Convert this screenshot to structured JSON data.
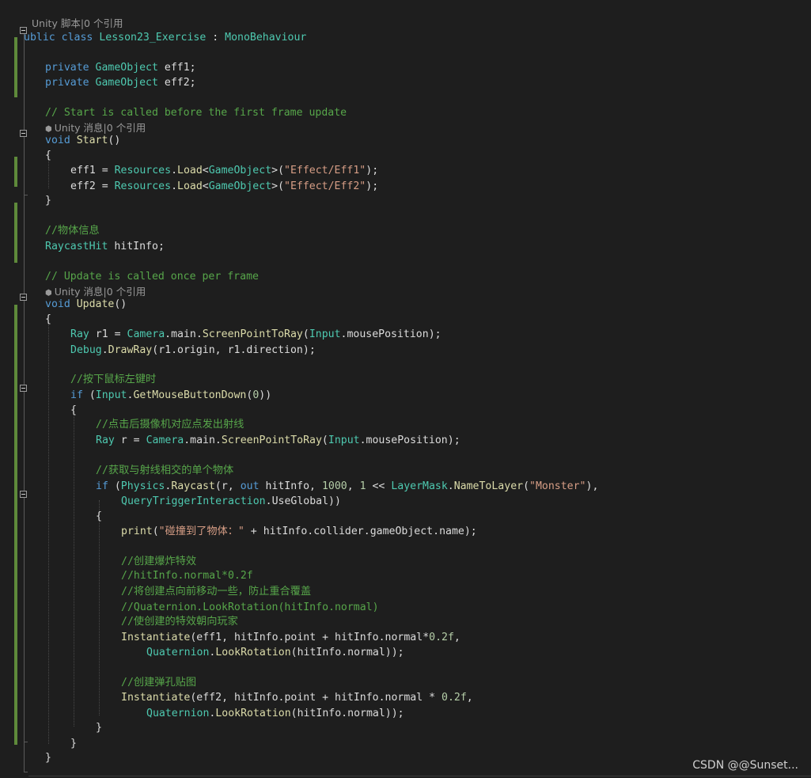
{
  "editor": {
    "lines": [
      {
        "kind": "lens",
        "text": "Unity 脚本|0 个引用"
      },
      {
        "kind": "code",
        "text": "ublic class Lesson23_Exercise : MonoBehaviour"
      },
      {
        "kind": "blank"
      },
      {
        "kind": "code",
        "text": "private GameObject eff1;"
      },
      {
        "kind": "code",
        "text": "private GameObject eff2;"
      },
      {
        "kind": "blank"
      },
      {
        "kind": "code",
        "text": "// Start is called before the first frame update"
      },
      {
        "kind": "lens",
        "text": "Unity 消息|0 个引用"
      },
      {
        "kind": "code",
        "text": "void Start()"
      },
      {
        "kind": "code",
        "text": "{"
      },
      {
        "kind": "code",
        "text": "eff1 = Resources.Load<GameObject>(\"Effect/Eff1\");"
      },
      {
        "kind": "code",
        "text": "eff2 = Resources.Load<GameObject>(\"Effect/Eff2\");"
      },
      {
        "kind": "code",
        "text": "}"
      },
      {
        "kind": "blank"
      },
      {
        "kind": "code",
        "text": "//物体信息"
      },
      {
        "kind": "code",
        "text": "RaycastHit hitInfo;"
      },
      {
        "kind": "blank"
      },
      {
        "kind": "code",
        "text": "// Update is called once per frame"
      },
      {
        "kind": "lens",
        "text": "Unity 消息|0 个引用"
      },
      {
        "kind": "code",
        "text": "void Update()"
      },
      {
        "kind": "code",
        "text": "{"
      },
      {
        "kind": "code",
        "text": "Ray r1 = Camera.main.ScreenPointToRay(Input.mousePosition);"
      },
      {
        "kind": "code",
        "text": "Debug.DrawRay(r1.origin, r1.direction);"
      },
      {
        "kind": "blank"
      },
      {
        "kind": "code",
        "text": "//按下鼠标左键时"
      },
      {
        "kind": "code",
        "text": "if (Input.GetMouseButtonDown(0))"
      },
      {
        "kind": "code",
        "text": "{"
      },
      {
        "kind": "code",
        "text": "//点击后摄像机对应点发出射线"
      },
      {
        "kind": "code",
        "text": "Ray r = Camera.main.ScreenPointToRay(Input.mousePosition);"
      },
      {
        "kind": "blank"
      },
      {
        "kind": "code",
        "text": "//获取与射线相交的单个物体"
      },
      {
        "kind": "code",
        "text": "if (Physics.Raycast(r, out hitInfo, 1000, 1 << LayerMask.NameToLayer(\"Monster\"),"
      },
      {
        "kind": "code",
        "text": "QueryTriggerInteraction.UseGlobal))"
      },
      {
        "kind": "code",
        "text": "{"
      },
      {
        "kind": "code",
        "text": "print(\"碰撞到了物体：\" + hitInfo.collider.gameObject.name);"
      },
      {
        "kind": "blank"
      },
      {
        "kind": "code",
        "text": "//创建爆炸特效"
      },
      {
        "kind": "code",
        "text": "//hitInfo.normal*0.2f"
      },
      {
        "kind": "code",
        "text": "//将创建点向前移动一些，防止重合覆盖"
      },
      {
        "kind": "code",
        "text": "//Quaternion.LookRotation(hitInfo.normal)"
      },
      {
        "kind": "code",
        "text": "//使创建的特效朝向玩家"
      },
      {
        "kind": "code",
        "text": "Instantiate(eff1, hitInfo.point + hitInfo.normal*0.2f,"
      },
      {
        "kind": "code",
        "text": "Quaternion.LookRotation(hitInfo.normal));"
      },
      {
        "kind": "blank"
      },
      {
        "kind": "code",
        "text": "//创建弹孔贴图"
      },
      {
        "kind": "code",
        "text": "Instantiate(eff2, hitInfo.point + hitInfo.normal * 0.2f,"
      },
      {
        "kind": "code",
        "text": "Quaternion.LookRotation(hitInfo.normal));"
      },
      {
        "kind": "code",
        "text": "}"
      },
      {
        "kind": "code",
        "text": "}"
      },
      {
        "kind": "code",
        "text": "}"
      }
    ]
  },
  "watermark": "CSDN @@Sunset..."
}
